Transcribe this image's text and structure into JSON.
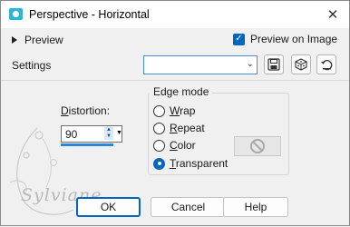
{
  "window": {
    "title": "Perspective - Horizontal",
    "close_glyph": "✕"
  },
  "preview": {
    "label": "Preview",
    "preview_on_image_label": "Preview on Image",
    "preview_on_image_checked": true
  },
  "settings": {
    "label": "Settings",
    "value": ""
  },
  "distortion": {
    "label_first": "D",
    "label_rest": "istortion:",
    "value": "90"
  },
  "edge_mode": {
    "title": "Edge mode",
    "options": [
      {
        "first": "W",
        "rest": "rap",
        "selected": false
      },
      {
        "first": "R",
        "rest": "epeat",
        "selected": false
      },
      {
        "first": "C",
        "rest": "olor",
        "selected": false
      },
      {
        "first": "T",
        "rest": "ransparent",
        "selected": true
      }
    ]
  },
  "watermark": {
    "text": "Sylviane"
  },
  "buttons": {
    "ok": "OK",
    "cancel": "Cancel",
    "help": "Help"
  },
  "colors": {
    "accent": "#0067c0",
    "app_icon": "#2cb5d6"
  }
}
